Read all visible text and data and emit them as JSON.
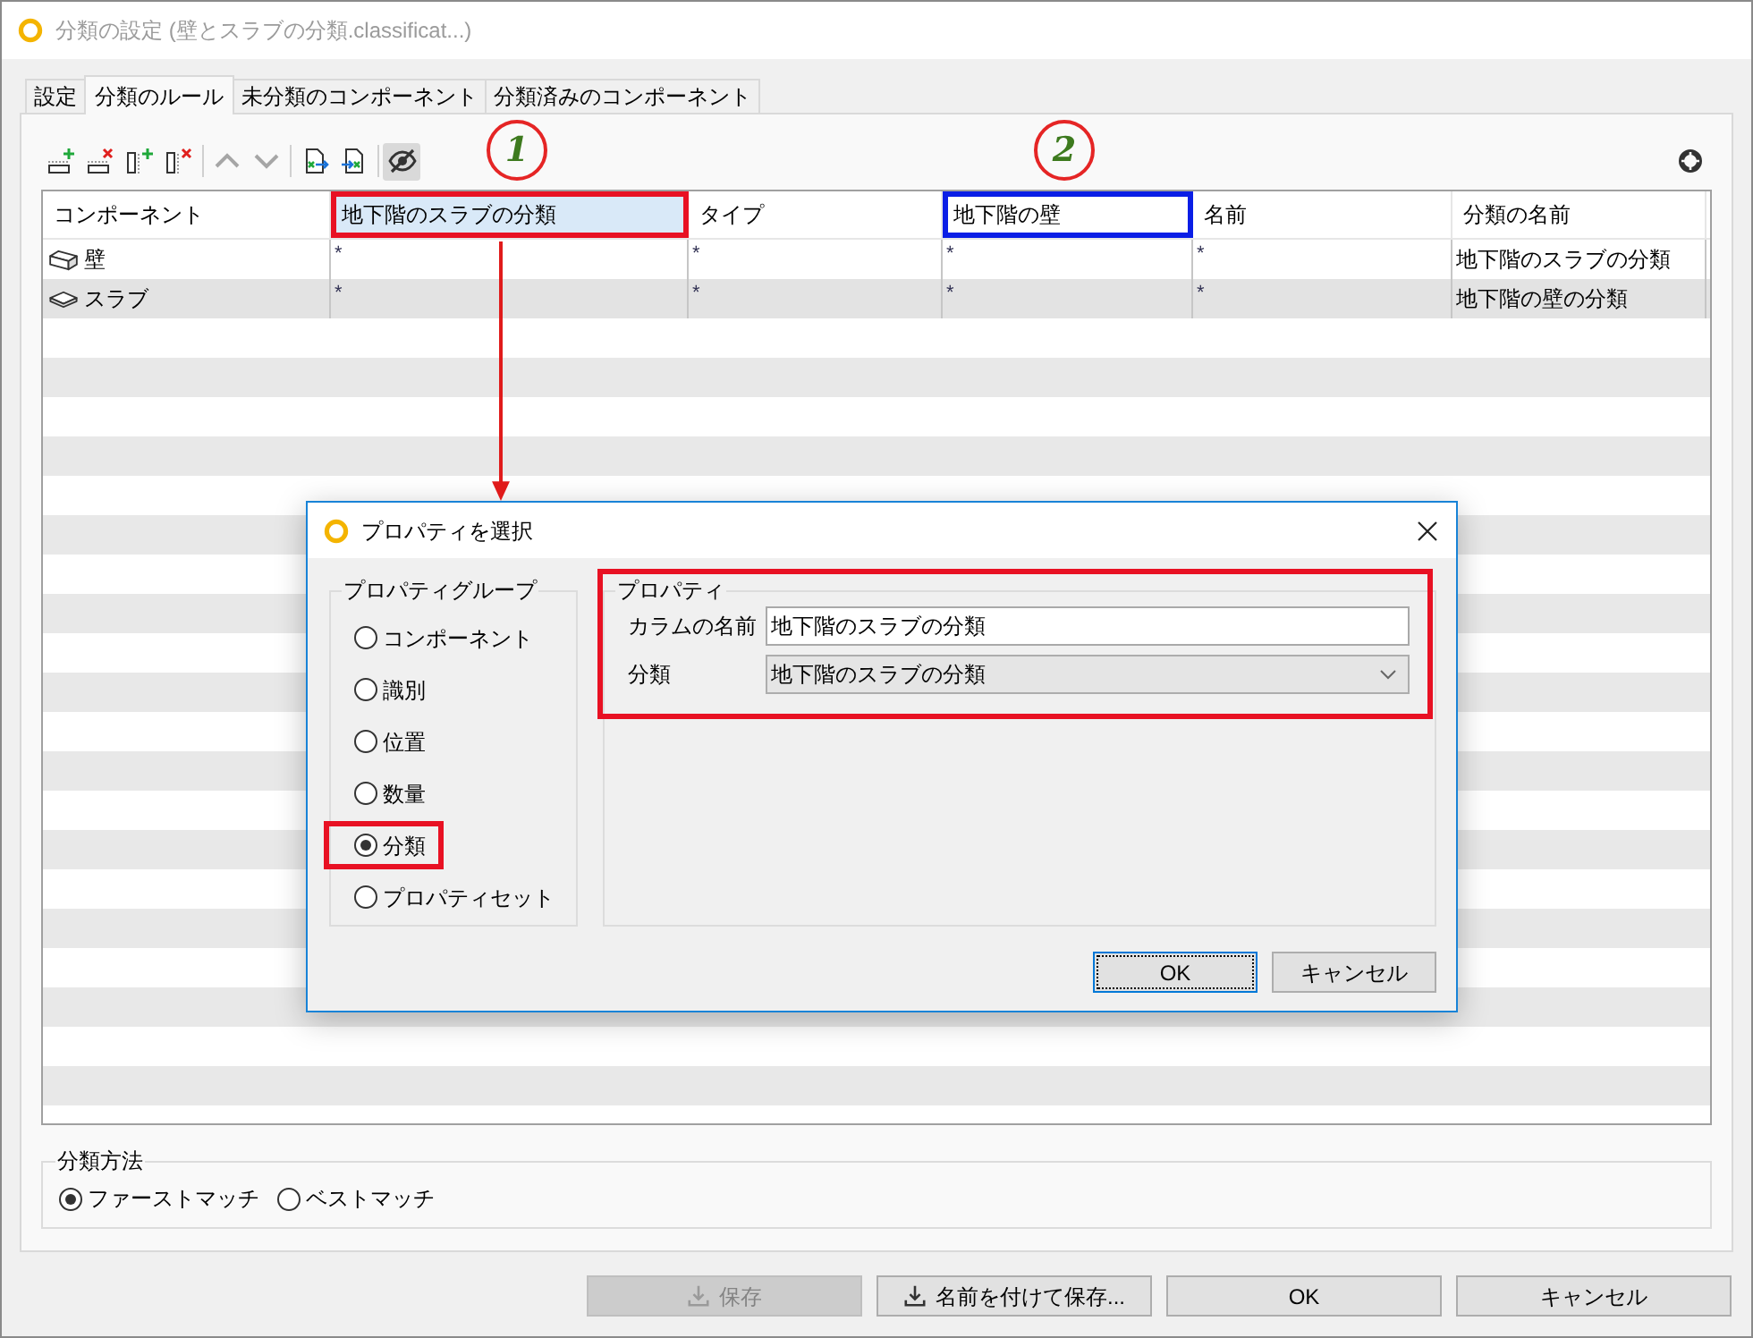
{
  "window": {
    "title": "分類の設定 (壁とスラブの分類.classificat...)"
  },
  "tabs": [
    {
      "label": "設定",
      "selected": false
    },
    {
      "label": "分類のルール",
      "selected": true
    },
    {
      "label": "未分類のコンポーネント",
      "selected": false
    },
    {
      "label": "分類済みのコンポーネント",
      "selected": false
    }
  ],
  "toolbar": {
    "items": [
      {
        "kind": "add-row",
        "disabled": false,
        "on": false
      },
      {
        "kind": "delete-row",
        "disabled": false,
        "on": false
      },
      {
        "kind": "add-column",
        "disabled": false,
        "on": false
      },
      {
        "kind": "delete-column",
        "disabled": false,
        "on": false
      },
      {
        "kind": "move-up",
        "disabled": true,
        "on": false
      },
      {
        "kind": "move-down",
        "disabled": true,
        "on": false
      },
      {
        "kind": "import",
        "disabled": false,
        "on": false
      },
      {
        "kind": "export",
        "disabled": false,
        "on": false
      },
      {
        "kind": "toggle-visibility",
        "disabled": false,
        "on": true
      }
    ]
  },
  "table": {
    "columns": [
      {
        "label": "コンポーネント",
        "selected": false
      },
      {
        "label": "地下階のスラブの分類",
        "selected": true,
        "color": "#e81123"
      },
      {
        "label": "タイプ",
        "selected": false
      },
      {
        "label": "地下階の壁",
        "selected": false,
        "color": "#0a1ee6"
      },
      {
        "label": "名前",
        "selected": false
      },
      {
        "label": "分類の名前",
        "selected": false
      }
    ],
    "rows": [
      {
        "kind": "wall",
        "cells": [
          "壁",
          "*",
          "*",
          "*",
          "*",
          "地下階のスラブの分類"
        ]
      },
      {
        "kind": "slab",
        "cells": [
          "スラブ",
          "*",
          "*",
          "*",
          "*",
          "地下階の壁の分類"
        ]
      }
    ]
  },
  "annotations": {
    "markers": [
      {
        "label": "1"
      },
      {
        "label": "2"
      }
    ]
  },
  "dialog": {
    "title": "プロパティを選択",
    "property_group": {
      "legend": "プロパティグループ",
      "options": [
        {
          "label": "コンポーネント",
          "selected": false,
          "outlined": false
        },
        {
          "label": "識別",
          "selected": false,
          "outlined": false
        },
        {
          "label": "位置",
          "selected": false,
          "outlined": false
        },
        {
          "label": "数量",
          "selected": false,
          "outlined": false
        },
        {
          "label": "分類",
          "selected": true,
          "outlined": true
        },
        {
          "label": "プロパティセット",
          "selected": false,
          "outlined": false
        }
      ]
    },
    "property": {
      "legend": "プロパティ",
      "outlined": true,
      "fields": [
        {
          "kind": "text",
          "label": "カラムの名前",
          "value": "地下階のスラブの分類"
        },
        {
          "kind": "dropdown",
          "label": "分類",
          "value": "地下階のスラブの分類"
        }
      ]
    },
    "buttons": [
      {
        "label": "OK",
        "focused": true
      },
      {
        "label": "キャンセル",
        "focused": false
      }
    ]
  },
  "classification_method": {
    "legend": "分類方法",
    "options": [
      {
        "label": "ファーストマッチ",
        "selected": true
      },
      {
        "label": "ベストマッチ",
        "selected": false
      }
    ]
  },
  "buttons": [
    {
      "kind": "download",
      "label": "保存",
      "disabled": true
    },
    {
      "kind": "download",
      "label": "名前を付けて保存...",
      "disabled": false
    },
    {
      "kind": "plain",
      "label": "OK",
      "disabled": false
    },
    {
      "kind": "plain",
      "label": "キャンセル",
      "disabled": false
    }
  ]
}
